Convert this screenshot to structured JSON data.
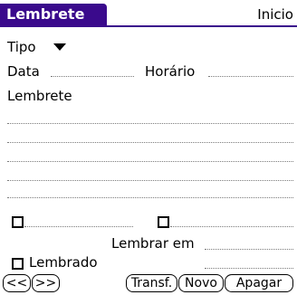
{
  "header": {
    "title": "Lembrete",
    "menu_right": "Inicio"
  },
  "form": {
    "tipo_label": "Tipo",
    "data_label": "Data",
    "horario_label": "Horário",
    "lembrete_label": "Lembrete",
    "lembrar_em_label": "Lembrar em",
    "lembrado_label": "Lembrado"
  },
  "buttons": {
    "prev": "<<",
    "next": ">>",
    "transf": "Transf.",
    "novo": "Novo",
    "apagar": "Apagar"
  },
  "colors": {
    "title_bar": "#3a0a8c",
    "title_text": "#ffffff"
  }
}
